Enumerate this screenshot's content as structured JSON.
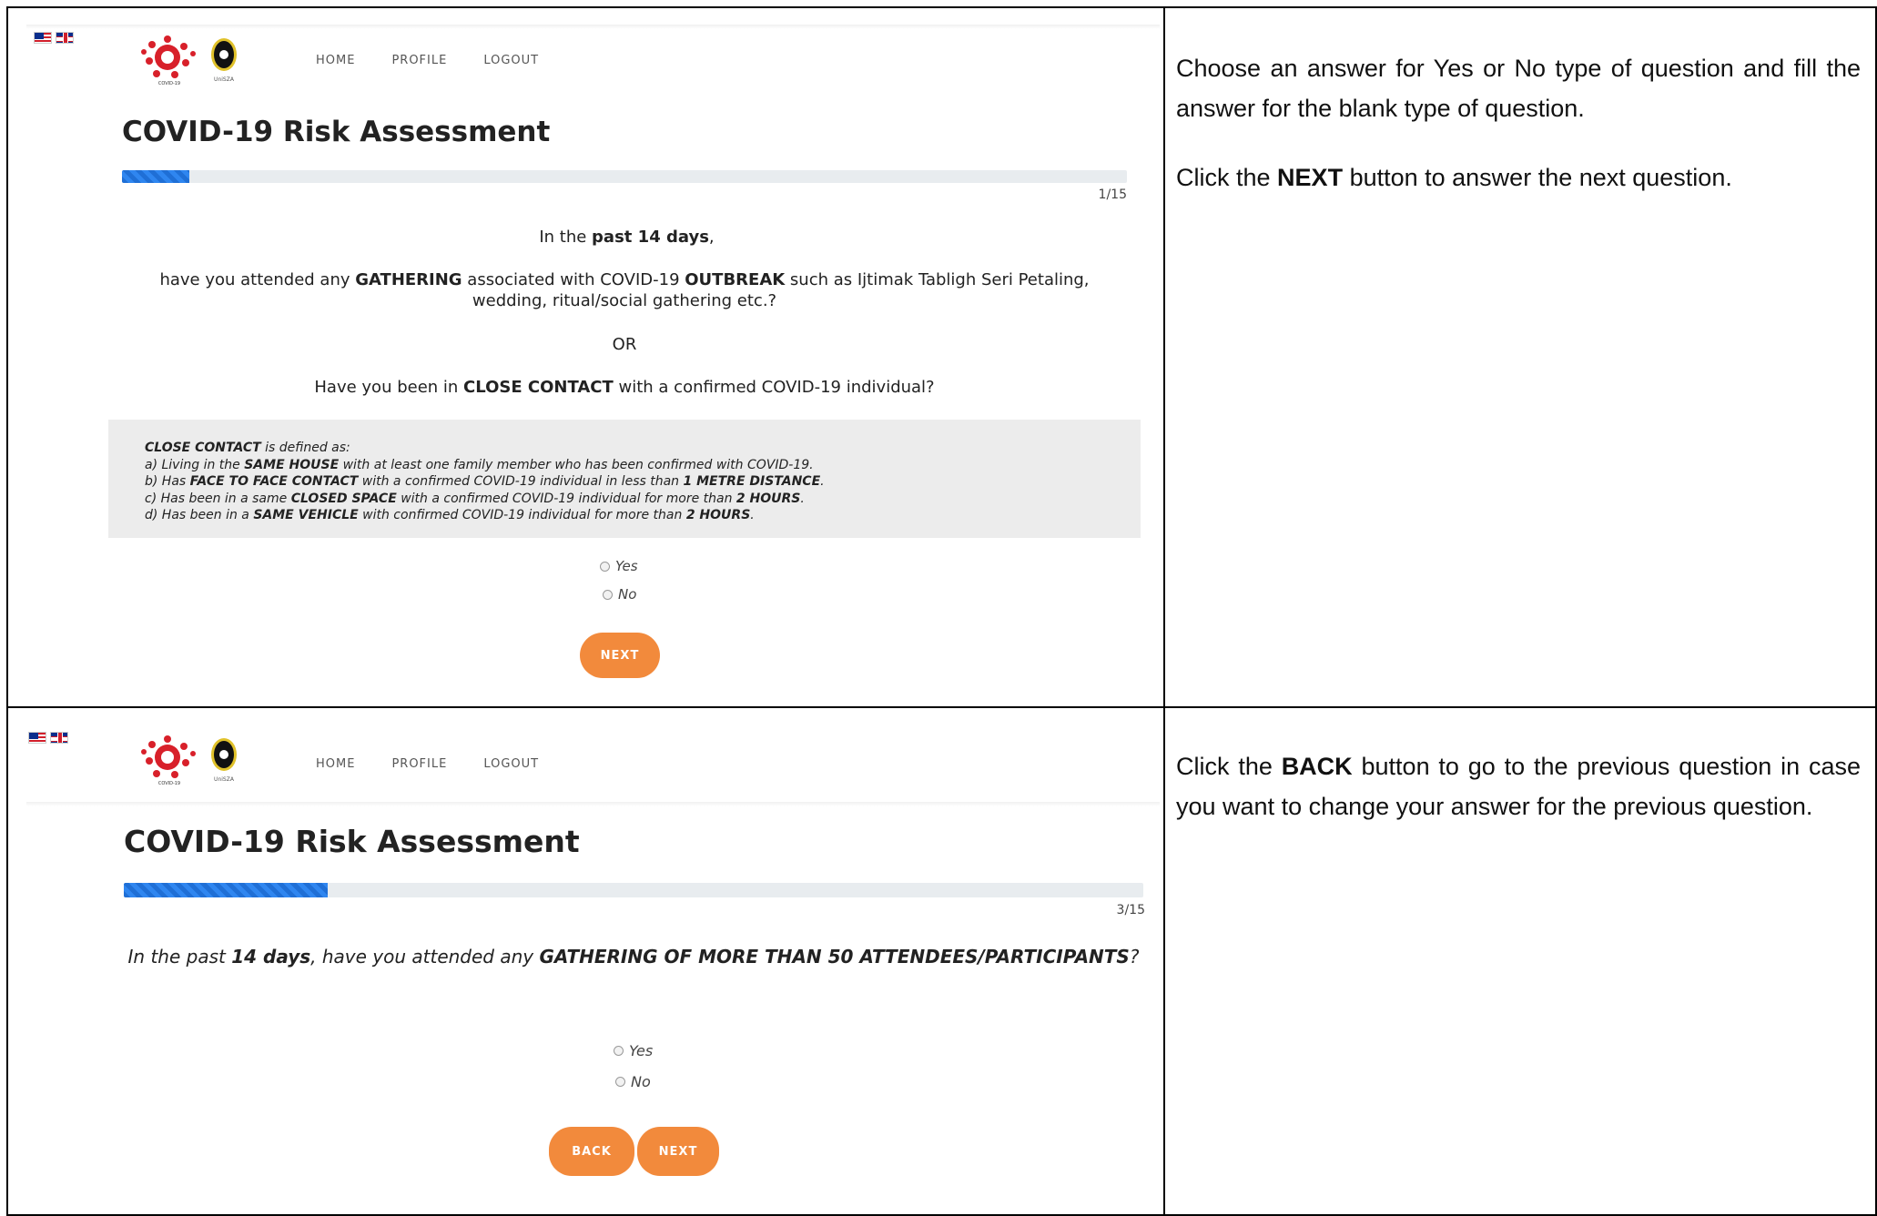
{
  "flags": {
    "ms": "Bahasa Melayu flag",
    "en": "English flag"
  },
  "logos": {
    "covid_text": "COVID-19",
    "univ_text": "UniSZA"
  },
  "nav": {
    "home": "HOME",
    "profile": "PROFILE",
    "logout": "LOGOUT"
  },
  "panel1": {
    "title": "COVID-19 Risk Assessment",
    "progress": {
      "current": 1,
      "total": 15,
      "fraction": 0.067,
      "label": "1/15"
    },
    "q_intro_pre": "In the ",
    "q_intro_bold": "past 14 days",
    "q_intro_post": ",",
    "q1_a": "have you attended any ",
    "q1_b": "GATHERING",
    "q1_c": " associated with COVID-19 ",
    "q1_d": "OUTBREAK",
    "q1_e": " such as Ijtimak Tabligh Seri Petaling, wedding, ritual/social gathering etc.?",
    "or": "OR",
    "q2_a": "Have you been in ",
    "q2_b": "CLOSE CONTACT",
    "q2_c": " with a confirmed COVID-19 individual?",
    "def": {
      "head_b": "CLOSE CONTACT",
      "head_t": " is defined as:",
      "a1": "a) Living in the ",
      "a2": "SAME HOUSE",
      "a3": " with at least one family member who has been confirmed with COVID-19.",
      "b1": "b) Has ",
      "b2": "FACE TO FACE CONTACT",
      "b3": " with a confirmed COVID-19 individual in less than ",
      "b4": "1 METRE DISTANCE",
      "b5": ".",
      "c1": "c) Has been in a same ",
      "c2": "CLOSED SPACE",
      "c3": " with a confirmed COVID-19 individual for more than ",
      "c4": "2 HOURS",
      "c5": ".",
      "d1": "d) Has been in a ",
      "d2": "SAME VEHICLE",
      "d3": " with confirmed COVID-19 individual for more than ",
      "d4": "2 HOURS",
      "d5": "."
    },
    "yes": "Yes",
    "no": "No",
    "next": "NEXT"
  },
  "panel2": {
    "title": "COVID-19 Risk Assessment",
    "progress": {
      "current": 3,
      "total": 15,
      "fraction": 0.2,
      "label": "3/15"
    },
    "q_a": "In the past ",
    "q_b": "14 days",
    "q_c": ", have you attended any ",
    "q_d": "GATHERING OF MORE THAN 50 ATTENDEES/PARTICIPANTS",
    "q_e": "?",
    "yes": "Yes",
    "no": "No",
    "back": "BACK",
    "next": "NEXT"
  },
  "instructions": {
    "i1": "Choose an answer for Yes or No type of question and fill the answer for the blank type of question.",
    "i2_pre": "Click the ",
    "i2_bold": "NEXT",
    "i2_post": " button to answer the next question.",
    "i3_pre": "Click the ",
    "i3_bold": "BACK",
    "i3_post": " button to go to the previous question in case you want to change your answer for the previous question."
  },
  "colors": {
    "accent": "#f28a3c",
    "progress": "#1f6fd6",
    "defbox": "#ececec"
  }
}
